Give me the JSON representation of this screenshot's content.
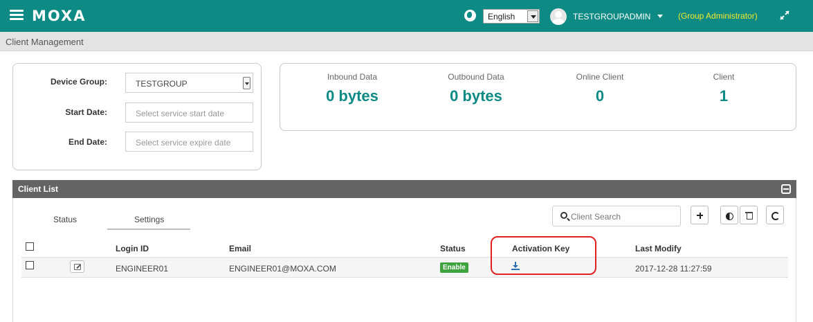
{
  "header": {
    "brand": "MOXA",
    "language": "English",
    "username": "TESTGROUPADMIN",
    "role": "(Group Administrator)",
    "icons": [
      "menu-icon",
      "globe-icon",
      "avatar",
      "chevron-down-icon",
      "expand-icon"
    ]
  },
  "breadcrumb": "Client Management",
  "filters": {
    "device_group_label": "Device Group:",
    "device_group_value": "TESTGROUP",
    "start_date_label": "Start Date:",
    "start_date_placeholder": "Select service start date",
    "end_date_label": "End Date:",
    "end_date_placeholder": "Select service expire date"
  },
  "stats": [
    {
      "label": "Inbound Data",
      "value": "0 bytes"
    },
    {
      "label": "Outbound Data",
      "value": "0 bytes"
    },
    {
      "label": "Online Client",
      "value": "0"
    },
    {
      "label": "Client",
      "value": "1"
    }
  ],
  "client_list": {
    "title": "Client List",
    "tabs": [
      "Status",
      "Settings"
    ],
    "active_tab": "Settings",
    "search_placeholder": "Client Search",
    "toolbar_icons": [
      "plus-icon",
      "toggle-icon",
      "trash-icon",
      "refresh-icon"
    ],
    "columns": [
      "Login ID",
      "Email",
      "Status",
      "Activation Key",
      "Last Modify"
    ],
    "rows": [
      {
        "login_id": "ENGINEER01",
        "email": "ENGINEER01@MOXA.COM",
        "status": "Enable",
        "activation_key_icon": "download-icon",
        "last_modify": "2017-12-28 11:27:59"
      }
    ]
  },
  "colors": {
    "brand_teal": "#0d8a83",
    "role_yellow": "#f2ea2e",
    "panel_header": "#646464",
    "status_green": "#3ea33e",
    "highlight_red": "#e02020"
  }
}
